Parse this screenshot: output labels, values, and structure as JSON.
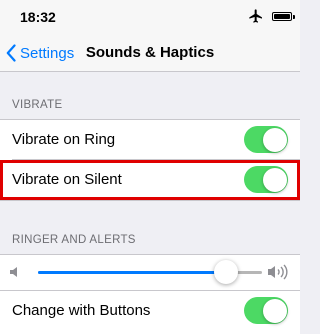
{
  "status_bar": {
    "time": "18:32",
    "airplane_icon": "airplane-icon",
    "battery_icon": "battery-icon"
  },
  "nav": {
    "back_label": "Settings",
    "title": "Sounds & Haptics"
  },
  "vibrate_section": {
    "header": "VIBRATE",
    "items": [
      {
        "label": "Vibrate on Ring",
        "on": true
      },
      {
        "label": "Vibrate on Silent",
        "on": true
      }
    ]
  },
  "ringer_section": {
    "header": "RINGER AND ALERTS",
    "volume_level": 0.84,
    "change_with_buttons": {
      "label": "Change with Buttons",
      "on": true
    }
  },
  "colors": {
    "accent": "#007aff",
    "switch_on": "#4cd964",
    "highlight": "#e00000"
  }
}
